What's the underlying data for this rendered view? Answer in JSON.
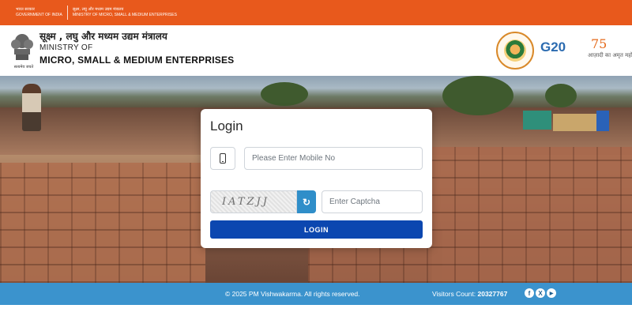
{
  "gov_strip": {
    "hindi_left": "भारत सरकार",
    "english_left": "GOVERNMENT OF INDIA",
    "hindi_right": "सूक्ष्म, लघु और मध्यम उद्यम मंत्रालय",
    "english_right": "MINISTRY OF MICRO, SMALL & MEDIUM ENTERPRISES"
  },
  "header": {
    "emblem_caption": "सत्यमेव जयते",
    "ministry_hindi": "सूक्ष्म , लघु और मध्यम उद्यम मंत्रालय",
    "ministry_of": "MINISTRY OF",
    "ministry_name": "MICRO, SMALL & MEDIUM ENTERPRISES",
    "logos": {
      "g20": "G20",
      "azadi_number": "75",
      "azadi_text": "आज़ादी का अमृत महोत्सव"
    }
  },
  "login": {
    "title": "Login",
    "mobile_placeholder": "Please Enter Mobile No",
    "captcha_text": "IATZJJ",
    "captcha_placeholder": "Enter Captcha",
    "button_label": "LOGIN"
  },
  "footer": {
    "copyright": "© 2025 PM Vishwakarma. All rights reserved.",
    "visitors_label": "Visitors Count:",
    "visitors_count": "20327767",
    "social": [
      "f",
      "X",
      "▶"
    ]
  },
  "colors": {
    "top_strip": "#e8591c",
    "primary_button": "#0c47b0",
    "refresh_button": "#2f8ec9",
    "footer": "#3b93cd"
  },
  "icons": [
    "mobile-phone-icon",
    "refresh-icon",
    "facebook-icon",
    "x-icon",
    "youtube-icon"
  ]
}
